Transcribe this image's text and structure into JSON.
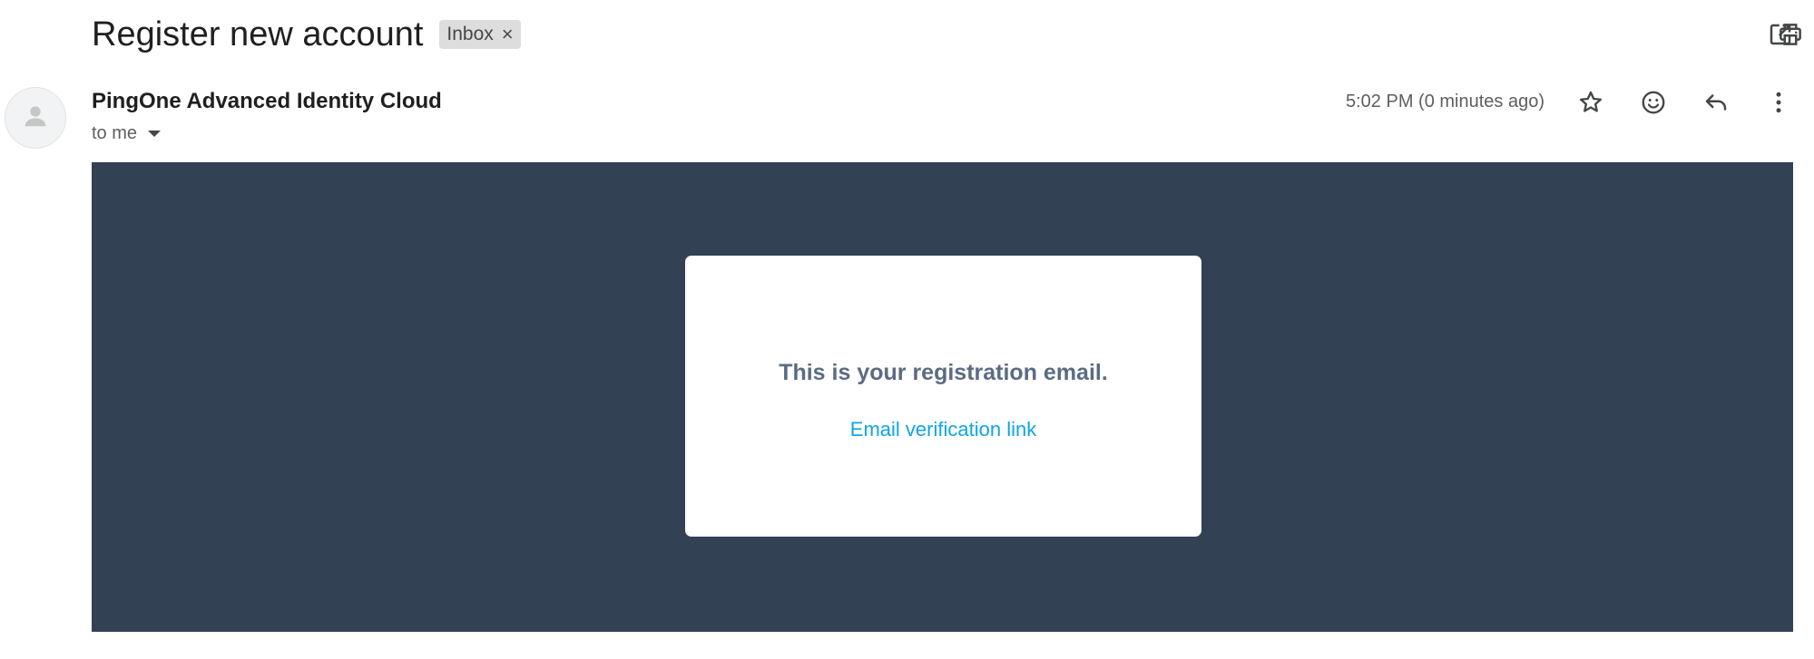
{
  "header": {
    "subject": "Register new account",
    "label_chip": "Inbox",
    "chip_remove_glyph": "×",
    "actions": [
      {
        "name": "print-icon"
      },
      {
        "name": "open-in-new-window-icon"
      }
    ]
  },
  "message": {
    "sender_name": "PingOne Advanced Identity Cloud",
    "recipient": "to me",
    "timestamp": "5:02 PM (0 minutes ago)",
    "actions": [
      {
        "name": "star-icon"
      },
      {
        "name": "emoji-reaction-icon"
      },
      {
        "name": "reply-icon"
      },
      {
        "name": "more-options-icon"
      }
    ]
  },
  "email_body": {
    "heading": "This is your registration email.",
    "link_text": "Email verification link",
    "banner_color": "#334155",
    "heading_color": "#5b6b83",
    "link_color": "#0ea5e9"
  }
}
